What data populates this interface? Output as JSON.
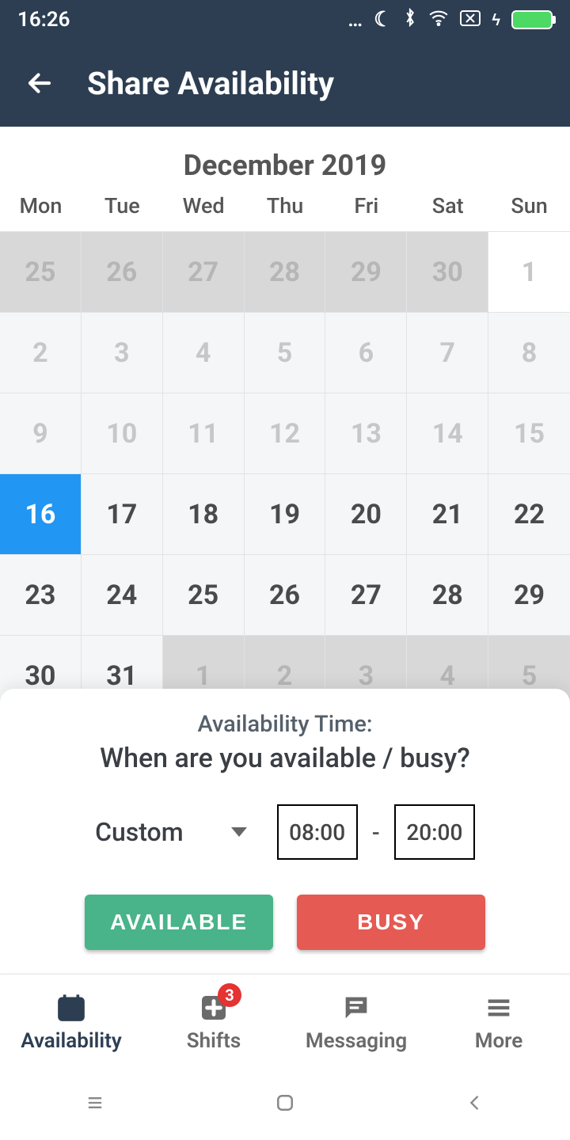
{
  "status": {
    "time": "16:26"
  },
  "header": {
    "title": "Share Availability"
  },
  "calendar": {
    "month_label": "December 2019",
    "dow": [
      "Mon",
      "Tue",
      "Wed",
      "Thu",
      "Fri",
      "Sat",
      "Sun"
    ],
    "cells": [
      {
        "n": "25",
        "cls": "other-month"
      },
      {
        "n": "26",
        "cls": "other-month"
      },
      {
        "n": "27",
        "cls": "other-month"
      },
      {
        "n": "28",
        "cls": "other-month"
      },
      {
        "n": "29",
        "cls": "other-month"
      },
      {
        "n": "30",
        "cls": "other-month"
      },
      {
        "n": "1",
        "cls": "other-month white past"
      },
      {
        "n": "2",
        "cls": "past"
      },
      {
        "n": "3",
        "cls": "past"
      },
      {
        "n": "4",
        "cls": "past"
      },
      {
        "n": "5",
        "cls": "past"
      },
      {
        "n": "6",
        "cls": "past"
      },
      {
        "n": "7",
        "cls": "past"
      },
      {
        "n": "8",
        "cls": "past"
      },
      {
        "n": "9",
        "cls": "past"
      },
      {
        "n": "10",
        "cls": "past"
      },
      {
        "n": "11",
        "cls": "past"
      },
      {
        "n": "12",
        "cls": "past"
      },
      {
        "n": "13",
        "cls": "past"
      },
      {
        "n": "14",
        "cls": "past"
      },
      {
        "n": "15",
        "cls": "past"
      },
      {
        "n": "16",
        "cls": "selected"
      },
      {
        "n": "17",
        "cls": ""
      },
      {
        "n": "18",
        "cls": ""
      },
      {
        "n": "19",
        "cls": ""
      },
      {
        "n": "20",
        "cls": ""
      },
      {
        "n": "21",
        "cls": ""
      },
      {
        "n": "22",
        "cls": ""
      },
      {
        "n": "23",
        "cls": ""
      },
      {
        "n": "24",
        "cls": ""
      },
      {
        "n": "25",
        "cls": ""
      },
      {
        "n": "26",
        "cls": ""
      },
      {
        "n": "27",
        "cls": ""
      },
      {
        "n": "28",
        "cls": ""
      },
      {
        "n": "29",
        "cls": ""
      },
      {
        "n": "30",
        "cls": ""
      },
      {
        "n": "31",
        "cls": ""
      },
      {
        "n": "1",
        "cls": "other-month"
      },
      {
        "n": "2",
        "cls": "other-month"
      },
      {
        "n": "3",
        "cls": "other-month"
      },
      {
        "n": "4",
        "cls": "other-month"
      },
      {
        "n": "5",
        "cls": "other-month"
      }
    ]
  },
  "sheet": {
    "title": "Availability Time:",
    "subtitle": "When are you available / busy?",
    "preset_label": "Custom",
    "time_from": "08:00",
    "time_sep": "-",
    "time_to": "20:00",
    "available_label": "AVAILABLE",
    "busy_label": "BUSY"
  },
  "nav": {
    "items": [
      {
        "label": "Availability"
      },
      {
        "label": "Shifts",
        "badge": "3"
      },
      {
        "label": "Messaging"
      },
      {
        "label": "More"
      }
    ]
  }
}
